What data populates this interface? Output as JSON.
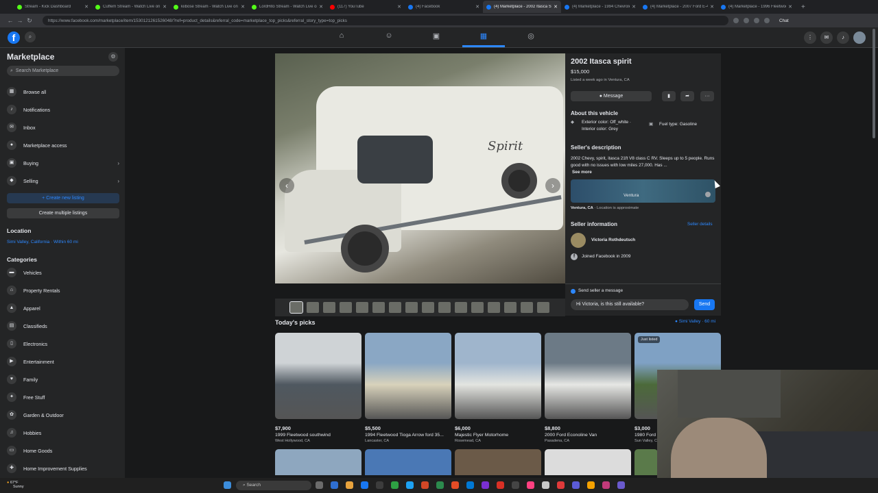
{
  "browser": {
    "tabs": [
      {
        "title": "Stream - Kick Dashboard",
        "color": "#53fc18",
        "active": false
      },
      {
        "title": "Cuffem Stream - Watch Live on K",
        "color": "#53fc18",
        "active": false
      },
      {
        "title": "kiibose Stream - Watch Live on K",
        "color": "#53fc18",
        "active": false
      },
      {
        "title": "LordHito Stream - Watch Live on",
        "color": "#53fc18",
        "active": false
      },
      {
        "title": "(117) YouTube",
        "color": "#ff0000",
        "active": false
      },
      {
        "title": "(4) Facebook",
        "color": "#1877f2",
        "active": false
      },
      {
        "title": "(4) Marketplace - 2002 Itasca Sp",
        "color": "#1877f2",
        "active": true
      },
      {
        "title": "(4) Marketplace - 1994 Chevrolet",
        "color": "#1877f2",
        "active": false
      },
      {
        "title": "(4) Marketplace - 2007 Ford E-4",
        "color": "#1877f2",
        "active": false
      },
      {
        "title": "(4) Marketplace - 1996 Fleetwoo",
        "color": "#1877f2",
        "active": false
      }
    ],
    "url": "https://www.facebook.com/marketplace/item/1530121261526048/?ref=product_details&referral_code=marketplace_top_picks&referral_story_type=top_picks",
    "chat_label": "Chat"
  },
  "sidebar": {
    "title": "Marketplace",
    "search_placeholder": "Search Marketplace",
    "nav": [
      {
        "label": "Browse all",
        "icon": "store-icon",
        "glyph": "▦",
        "chev": ""
      },
      {
        "label": "Notifications",
        "icon": "bell-icon",
        "glyph": "♪",
        "chev": ""
      },
      {
        "label": "Inbox",
        "icon": "inbox-icon",
        "glyph": "✉",
        "chev": ""
      },
      {
        "label": "Marketplace access",
        "icon": "lock-icon",
        "glyph": "●",
        "chev": ""
      },
      {
        "label": "Buying",
        "icon": "bag-icon",
        "glyph": "▣",
        "chev": "›"
      },
      {
        "label": "Selling",
        "icon": "tag-icon",
        "glyph": "◆",
        "chev": "›"
      }
    ],
    "create_listing": "+ Create new listing",
    "create_multiple": "Create multiple listings",
    "location_heading": "Location",
    "location_value": "Simi Valley, California · Within 60 mi",
    "categories_heading": "Categories",
    "categories": [
      {
        "label": "Vehicles",
        "icon": "car-icon",
        "glyph": "▬"
      },
      {
        "label": "Property Rentals",
        "icon": "house-icon",
        "glyph": "⌂"
      },
      {
        "label": "Apparel",
        "icon": "shirt-icon",
        "glyph": "▲"
      },
      {
        "label": "Classifieds",
        "icon": "classifieds-icon",
        "glyph": "▤"
      },
      {
        "label": "Electronics",
        "icon": "phone-icon",
        "glyph": "▯"
      },
      {
        "label": "Entertainment",
        "icon": "film-icon",
        "glyph": "▶"
      },
      {
        "label": "Family",
        "icon": "heart-icon",
        "glyph": "♥"
      },
      {
        "label": "Free Stuff",
        "icon": "gift-icon",
        "glyph": "✦"
      },
      {
        "label": "Garden & Outdoor",
        "icon": "leaf-icon",
        "glyph": "✿"
      },
      {
        "label": "Hobbies",
        "icon": "guitar-icon",
        "glyph": "♫"
      },
      {
        "label": "Home Goods",
        "icon": "sofa-icon",
        "glyph": "▭"
      },
      {
        "label": "Home Improvement Supplies",
        "icon": "hammer-icon",
        "glyph": "✚"
      }
    ]
  },
  "listing": {
    "title": "2002 Itasca spirit",
    "price": "$15,000",
    "listed": "Listed a week ago in Ventura, CA",
    "message_button": "Message",
    "about_heading": "About this vehicle",
    "exterior": "Exterior color: Off_white · Interior color: Grey",
    "fuel": "Fuel type: Gasoline",
    "desc_heading": "Seller's description",
    "description": "2002 Chevy, spirit, itasca 21ft V8 class C RV. Sleeps up to 5 people. Runs good with no issues with low miles 27,000. Has ...",
    "see_more": "See more",
    "map_label": "Ventura",
    "location_city": "Ventura, CA",
    "location_note": " · Location is approximate",
    "seller_heading": "Seller information",
    "seller_details": "Seller details",
    "seller_name": "Victoria Rothdeutsch",
    "joined": "Joined Facebook in 2009",
    "photo_text": "Spirit"
  },
  "message_box": {
    "label": "Send seller a message",
    "input_value": "Hi Victoria, is this still available?",
    "send": "Send"
  },
  "picks": {
    "heading": "Today's picks",
    "location": "Simi Valley · 60 mi",
    "cards": [
      {
        "price": "$7,900",
        "name": "1999 Fleetwood southwind",
        "loc": "West Hollywood, CA",
        "badge": "",
        "c1": "#cfd3d6",
        "c2": "#4f5860"
      },
      {
        "price": "$5,500",
        "name": "1994 Fleetwood Tioga Arrow ford 35...",
        "loc": "Lancaster, CA",
        "badge": "",
        "c1": "#8aa7c4",
        "c2": "#d8d2bb"
      },
      {
        "price": "$6,000",
        "name": "Majestic Flyer Motorhome",
        "loc": "Rosemead, CA",
        "badge": "",
        "c1": "#9fb5cc",
        "c2": "#e3e4e0"
      },
      {
        "price": "$8,800",
        "name": "2000 Ford Econoline Van",
        "loc": "Pasadena, CA",
        "badge": "",
        "c1": "#6c7a86",
        "c2": "#e6e7e4"
      },
      {
        "price": "$3,000",
        "name": "1980 Ford",
        "loc": "Sun Valley, CA",
        "badge": "Just listed",
        "c1": "#7fa1c4",
        "c2": "#4c6a3a"
      }
    ]
  },
  "taskbar": {
    "weather_temp": "67°F",
    "weather_text": "Sunny",
    "search": "Search"
  }
}
